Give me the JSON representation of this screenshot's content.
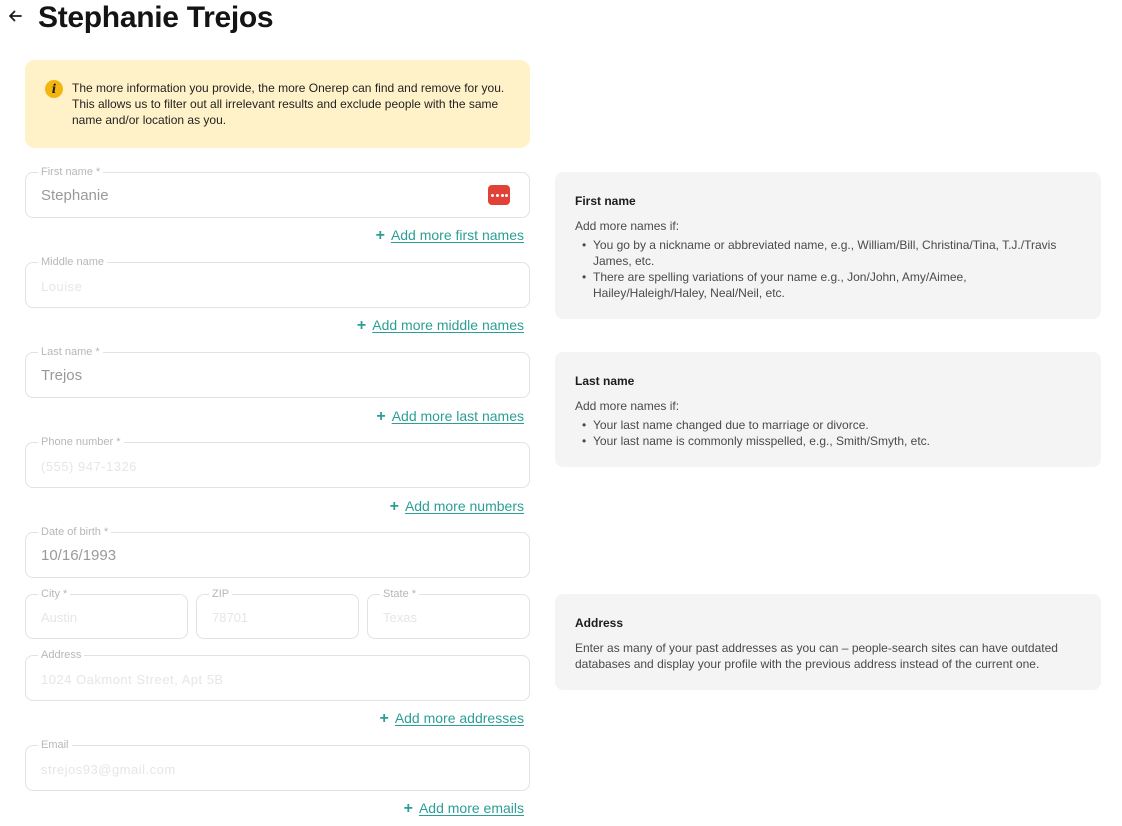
{
  "header": {
    "title": "Stephanie Trejos"
  },
  "notice": {
    "text": "The more information you provide, the more Onerep can find and remove for you. This allows us to filter out all irrelevant results and exclude people with the same name and/or location as you."
  },
  "form": {
    "first_name": {
      "label": "First name *",
      "value": "Stephanie"
    },
    "middle_name": {
      "label": "Middle name",
      "value": "Louise"
    },
    "last_name": {
      "label": "Last name *",
      "value": "Trejos"
    },
    "phone": {
      "label": "Phone number *",
      "value": "(555) 947-1326"
    },
    "dob": {
      "label": "Date of birth *",
      "value": "10/16/1993"
    },
    "city": {
      "label": "City *",
      "value": "Austin"
    },
    "zip": {
      "label": "ZIP",
      "value": "78701"
    },
    "state": {
      "label": "State *",
      "value": "Texas"
    },
    "address": {
      "label": "Address",
      "value": "1024 Oakmont Street, Apt 5B"
    },
    "email": {
      "label": "Email",
      "value": "strejos93@gmail.com"
    }
  },
  "links": {
    "first_names": "Add more first names",
    "middle_names": "Add more middle names",
    "last_names": "Add more last names",
    "numbers": "Add more numbers",
    "addresses": "Add more addresses",
    "emails": "Add more emails",
    "plus": "+"
  },
  "help": {
    "first_name": {
      "title": "First name",
      "intro": "Add more names if:",
      "items": [
        "You go by a nickname or abbreviated name, e.g., William/Bill, Christina/Tina, T.J./Travis James, etc.",
        "There are spelling variations of your name e.g., Jon/John, Amy/Aimee, Hailey/Haleigh/Haley, Neal/Neil, etc."
      ]
    },
    "last_name": {
      "title": "Last name",
      "intro": "Add more names if:",
      "items": [
        "Your last name changed due to marriage or divorce.",
        "Your last name is commonly misspelled, e.g., Smith/Smyth, etc."
      ]
    },
    "address": {
      "title": "Address",
      "intro": "Enter as many of your past addresses as you can – people-search sites can have outdated databases and display your profile with the previous address instead of the current one."
    }
  },
  "icons": {
    "back": "arrow-left-icon",
    "info": "info-icon",
    "password_manager": "password-manager-icon"
  },
  "colors": {
    "accent": "#2b9f95",
    "notice_bg": "#fff1c8",
    "info_icon": "#f3b610",
    "password_icon": "#e24137",
    "card_bg": "#f4f4f4"
  }
}
